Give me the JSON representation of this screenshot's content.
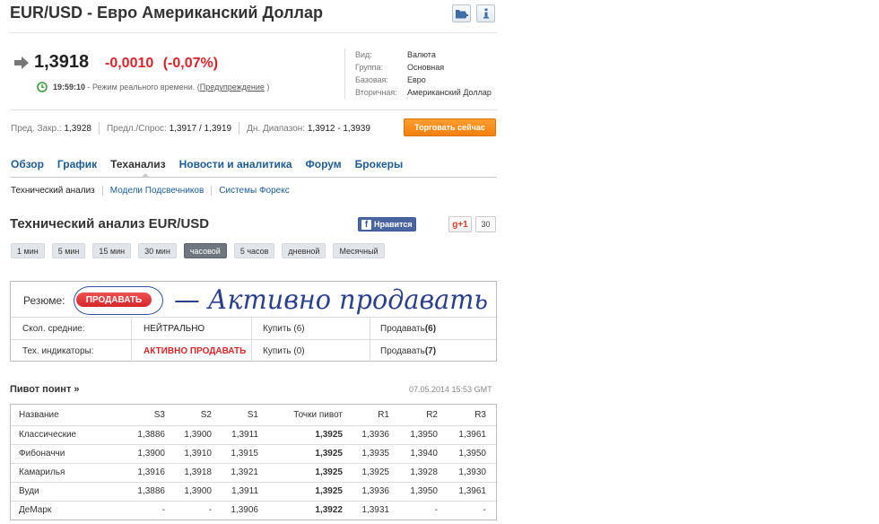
{
  "header": {
    "title": "EUR/USD - Евро Американский Доллар",
    "folder_icon": "add-to-portfolio-icon",
    "info_icon": "info-icon"
  },
  "quote": {
    "price": "1,3918",
    "change": "-0,0010",
    "change_pct": "(-0,07%)",
    "time": "19:59:10",
    "realtime_text": " - Режим реального времени. (",
    "warning_link": "Предупреждение",
    "realtime_close": " )",
    "colors": {
      "down": "#d7262b",
      "clock": "#3a9b3a"
    }
  },
  "info": [
    {
      "key": "Вид:",
      "value": "Валюта"
    },
    {
      "key": "Группа:",
      "value": "Основная"
    },
    {
      "key": "Базовая:",
      "value": "Евро"
    },
    {
      "key": "Вторичная:",
      "value": "Американский Доллар"
    }
  ],
  "stats": {
    "prev_close_label": "Пред. Закр.:",
    "prev_close": "1,3928",
    "bid_ask_label": "Предл./Спрос:",
    "bid_ask": "1,3917 / 1,3919",
    "range_label": "Дн. Диапазон:",
    "range": "1,3912 - 1,3939",
    "trade_button": "Торговать сейчас"
  },
  "tabs": [
    "Обзор",
    "График",
    "Теханализ",
    "Новости и аналитика",
    "Форум",
    "Брокеры"
  ],
  "subtabs": [
    "Технический анализ",
    "Модели Подсвечников",
    "Системы Форекс"
  ],
  "section": {
    "title": "Технический анализ EUR/USD",
    "fb_like": "Нравится",
    "gplus": "g+1",
    "gplus_count": "30"
  },
  "timeframes": [
    "1 мин",
    "5 мин",
    "15 мин",
    "30 мин",
    "часовой",
    "5 часов",
    "дневной",
    "Месячный"
  ],
  "summary": {
    "label": "Резюме:",
    "verdict": "ПРОДАВАТЬ",
    "rows": [
      {
        "name": "Скол. средние:",
        "signal": "НЕЙТРАЛЬНО",
        "buy": "Купить (6)",
        "sell_label": "Продавать ",
        "sell_count": "(6)"
      },
      {
        "name": "Тех. индикаторы:",
        "signal": "АКТИВНО ПРОДАВАТЬ",
        "buy": "Купить (0)",
        "sell_label": "Продавать ",
        "sell_count": "(7)"
      }
    ],
    "handwriting": "— Активно продавать"
  },
  "pivot": {
    "title": "Пивот поинт »",
    "timestamp": "07.05.2014 15:53 GMT",
    "columns": [
      "Название",
      "S3",
      "S2",
      "S1",
      "Точки пивот",
      "R1",
      "R2",
      "R3"
    ],
    "rows": [
      [
        "Классические",
        "1,3886",
        "1,3900",
        "1,3911",
        "1,3925",
        "1,3936",
        "1,3950",
        "1,3961"
      ],
      [
        "Фибоначчи",
        "1,3900",
        "1,3910",
        "1,3915",
        "1,3925",
        "1,3935",
        "1,3940",
        "1,3950"
      ],
      [
        "Камарилья",
        "1,3916",
        "1,3918",
        "1,3921",
        "1,3925",
        "1,3925",
        "1,3928",
        "1,3930"
      ],
      [
        "Вуди",
        "1,3886",
        "1,3900",
        "1,3911",
        "1,3925",
        "1,3936",
        "1,3950",
        "1,3961"
      ],
      [
        "ДеМарк",
        "-",
        "-",
        "1,3906",
        "1,3922",
        "1,3931",
        "-",
        "-"
      ]
    ]
  }
}
